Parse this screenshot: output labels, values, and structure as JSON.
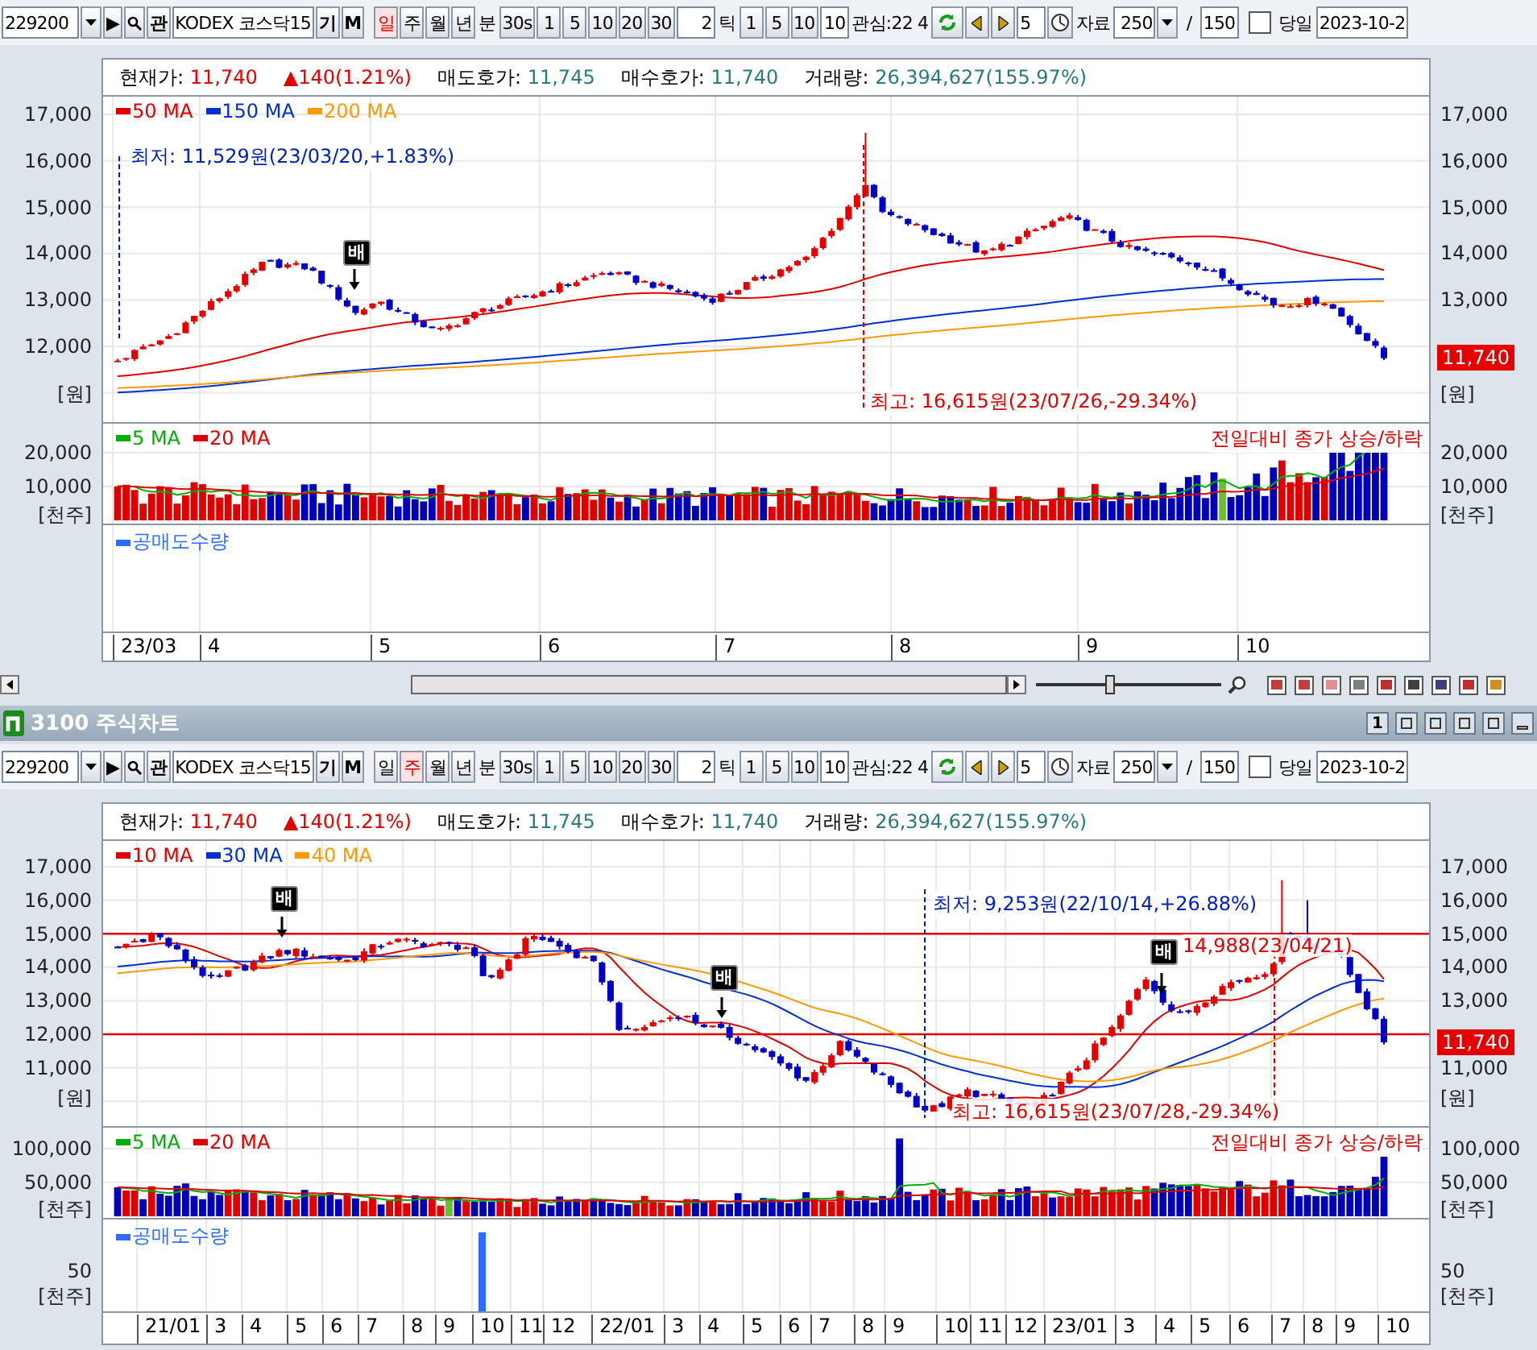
{
  "top_toolbar": {
    "code": "229200",
    "play": "▶",
    "watch_button": "관",
    "name": "KODEX 코스닥15",
    "buttons": [
      "기",
      "M"
    ],
    "periods": [
      {
        "label": "일",
        "selected": true
      },
      {
        "label": "주",
        "selected": false
      },
      {
        "label": "월",
        "selected": false
      },
      {
        "label": "년",
        "selected": false
      }
    ],
    "minute_label": "분",
    "minute_combo": "30s",
    "minute_buttons": [
      "1",
      "5",
      "10",
      "20",
      "30"
    ],
    "minute_input": "2",
    "tick_label": "틱",
    "tick_buttons": [
      "1",
      "5",
      "10"
    ],
    "tick_input": "10",
    "interest": "관심:22 4",
    "step_input": "5",
    "data_label": "자료",
    "data_count": "250",
    "slash": "/",
    "view_count": "150",
    "today": {
      "label": "당일",
      "checked": false
    },
    "date": "2023-10-2"
  },
  "top_chart": {
    "quotes": [
      {
        "label": "현재가:",
        "value": "11,740",
        "color": "#e00000"
      },
      {
        "value": "▲140(1.21%)",
        "color": "#e00000"
      },
      {
        "label": "매도호가:",
        "value": "11,745",
        "color": "#2a7a7a"
      },
      {
        "label": "매수호가:",
        "value": "11,740",
        "color": "#2a7a7a"
      },
      {
        "label": "거래량:",
        "value": "26,394,627(155.97%)",
        "color": "#2a7a7a"
      }
    ],
    "price_panel": {
      "legend": [
        {
          "label": "50 MA",
          "color": "#e00000"
        },
        {
          "label": "150 MA",
          "color": "#0030d0"
        },
        {
          "label": "200 MA",
          "color": "#ff9900"
        }
      ],
      "left_ticks": [
        "17,000",
        "16,000",
        "15,000",
        "14,000",
        "13,000",
        "12,000"
      ],
      "left_unit": "[원]",
      "right_ticks": [
        "17,000",
        "16,000",
        "15,000",
        "14,000",
        "13,000"
      ],
      "right_unit": "[원]",
      "price_tag": "11,740",
      "annotations": [
        {
          "kind": "low",
          "text": "최저: 11,529원(23/03/20,+1.83%)"
        },
        {
          "kind": "high",
          "text": "최고: 16,615원(23/07/26,-29.34%)"
        }
      ],
      "signals": [
        "배"
      ]
    },
    "volume_panel": {
      "legend": [
        {
          "label": "5 MA",
          "color": "#00b000"
        },
        {
          "label": "20 MA",
          "color": "#e00000"
        }
      ],
      "caption": "전일대비 종가 상승/하락",
      "left_ticks": [
        "20,000",
        "10,000"
      ],
      "left_unit": "[천주]",
      "right_ticks": [
        "20,000",
        "10,000"
      ],
      "right_unit": "[천주]"
    },
    "short_panel": {
      "legend": [
        {
          "label": "공매도수량",
          "color": "#2e6cff"
        }
      ]
    },
    "x_axis": [
      "23/03",
      "4",
      "5",
      "6",
      "7",
      "8",
      "9",
      "10"
    ]
  },
  "zoom_slider": {
    "level": 0.4
  },
  "window": {
    "title": "3100 주식차트",
    "button": "1"
  },
  "bottom_toolbar": {
    "code": "229200",
    "play": "▶",
    "watch_button": "관",
    "name": "KODEX 코스닥15",
    "buttons": [
      "기",
      "M"
    ],
    "periods": [
      {
        "label": "일",
        "selected": false
      },
      {
        "label": "주",
        "selected": true
      },
      {
        "label": "월",
        "selected": false
      },
      {
        "label": "년",
        "selected": false
      }
    ],
    "minute_label": "분",
    "minute_combo": "30s",
    "minute_buttons": [
      "1",
      "5",
      "10",
      "20",
      "30"
    ],
    "minute_input": "2",
    "tick_label": "틱",
    "tick_buttons": [
      "1",
      "5",
      "10"
    ],
    "tick_input": "10",
    "interest": "관심:22 4",
    "step_input": "5",
    "data_label": "자료",
    "data_count": "250",
    "slash": "/",
    "view_count": "150",
    "today": {
      "label": "당일",
      "checked": false
    },
    "date": "2023-10-2"
  },
  "bottom_chart": {
    "quotes": [
      {
        "label": "현재가:",
        "value": "11,740",
        "color": "#e00000"
      },
      {
        "value": "▲140(1.21%)",
        "color": "#e00000"
      },
      {
        "label": "매도호가:",
        "value": "11,745",
        "color": "#2a7a7a"
      },
      {
        "label": "매수호가:",
        "value": "11,740",
        "color": "#2a7a7a"
      },
      {
        "label": "거래량:",
        "value": "26,394,627(155.97%)",
        "color": "#2a7a7a"
      }
    ],
    "price_panel": {
      "legend": [
        {
          "label": "10 MA",
          "color": "#e00000"
        },
        {
          "label": "30 MA",
          "color": "#0030d0"
        },
        {
          "label": "40 MA",
          "color": "#ff9900"
        }
      ],
      "left_ticks": [
        "17,000",
        "16,000",
        "15,000",
        "14,000",
        "13,000",
        "12,000",
        "11,000"
      ],
      "left_unit": "[원]",
      "right_ticks": [
        "17,000",
        "16,000",
        "15,000",
        "14,000",
        "13,000",
        "11,000"
      ],
      "right_unit": "[원]",
      "price_tag": "11,740",
      "annotations": [
        {
          "kind": "low",
          "text": "최저: 9,253원(22/10/14,+26.88%)"
        },
        {
          "kind": "high",
          "text": "최고: 16,615원(23/07/28,-29.34%)"
        },
        {
          "kind": "mark",
          "text": "14,988(23/04/21)"
        }
      ],
      "signals": [
        "배",
        "배",
        "배"
      ]
    },
    "volume_panel": {
      "legend": [
        {
          "label": "5 MA",
          "color": "#00b000"
        },
        {
          "label": "20 MA",
          "color": "#e00000"
        }
      ],
      "caption": "전일대비 종가 상승/하락",
      "left_ticks": [
        "100,000",
        "50,000"
      ],
      "left_unit": "[천주]",
      "right_ticks": [
        "100,000",
        "50,000"
      ],
      "right_unit": "[천주]"
    },
    "short_panel": {
      "legend": [
        {
          "label": "공매도수량",
          "color": "#2e6cff"
        }
      ],
      "left_ticks": [
        "50"
      ],
      "left_unit": "[천주]",
      "right_ticks": [
        "50"
      ],
      "right_unit": "[천주]"
    },
    "x_axis": [
      "21/01",
      "3",
      "4",
      "5",
      "6",
      "7",
      "8",
      "9",
      "10",
      "11",
      "12",
      "22/01",
      "3",
      "4",
      "5",
      "6",
      "7",
      "8",
      "9",
      "10",
      "11",
      "12",
      "23/01",
      "3",
      "4",
      "5",
      "6",
      "7",
      "8",
      "9",
      "10"
    ]
  }
}
